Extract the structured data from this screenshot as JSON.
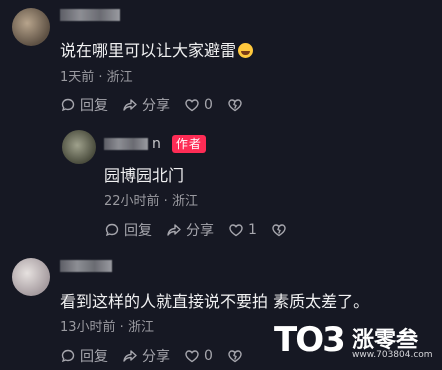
{
  "comments": [
    {
      "username_suffix": "",
      "text": "说在哪里可以让大家避雷",
      "meta": "1天前 · 浙江",
      "actions": {
        "reply": "回复",
        "share": "分享",
        "likes": "0"
      }
    },
    {
      "username_suffix": "n",
      "badge": "作者",
      "text": "园博园北门",
      "meta": "22小时前 · 浙江",
      "actions": {
        "reply": "回复",
        "share": "分享",
        "likes": "1"
      }
    },
    {
      "username_suffix": "",
      "text": "看到这样的人就直接说不要拍 素质太差了。",
      "meta": "13小时前 · 浙江",
      "actions": {
        "reply": "回复",
        "share": "分享",
        "likes": "0"
      }
    }
  ],
  "watermark": {
    "logo_text": "TO3",
    "brand": "涨零叁",
    "url": "www.703804.com"
  },
  "icons": [
    "reply-bubble-icon",
    "share-arrow-icon",
    "like-heart-icon",
    "dislike-heart-icon"
  ],
  "colors": {
    "background": "#161823",
    "badge": "#fe2c55",
    "text": "#f1f1f2",
    "secondary": "#9a9aa0"
  }
}
